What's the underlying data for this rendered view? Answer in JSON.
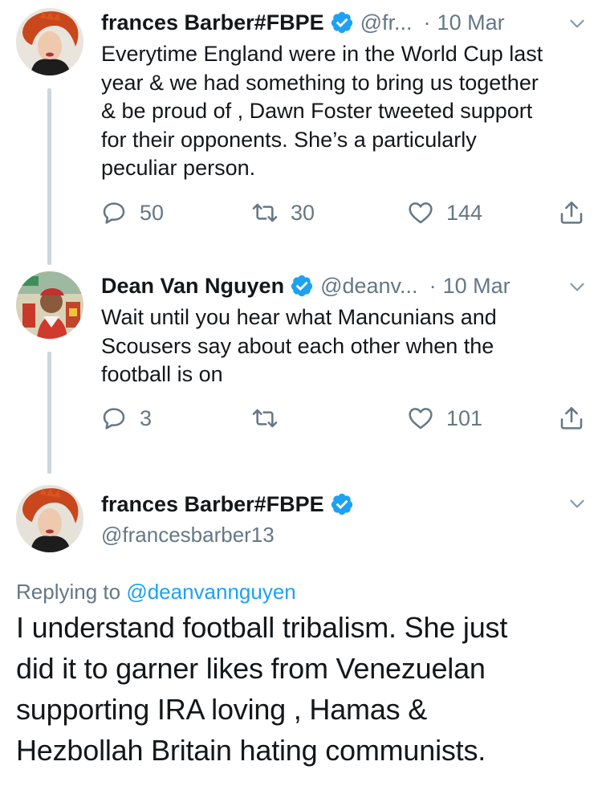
{
  "tweets": [
    {
      "name": "frances Barber#FBPE",
      "handle": "@fr...",
      "separator": "·",
      "date": "10 Mar",
      "text_lines": [
        "Everytime England were in the World Cup last",
        "year & we had something to bring us together",
        "& be proud of , Dawn Foster tweeted support",
        "for their opponents. She’s a particularly",
        "peculiar person."
      ],
      "replies": "50",
      "retweets": "30",
      "likes": "144"
    },
    {
      "name": "Dean Van Nguyen",
      "handle": "@deanv...",
      "separator": "·",
      "date": "10 Mar",
      "text_lines": [
        "Wait until you hear what Mancunians and",
        "Scousers say about each other when the",
        "football is on"
      ],
      "replies": "3",
      "retweets": "",
      "likes": "101"
    }
  ],
  "main_tweet": {
    "name": "frances Barber#FBPE",
    "handle": "@francesbarber13",
    "replying_prefix": "Replying to",
    "replying_to": "@deanvannguyen",
    "text_lines": [
      "I understand football tribalism. She just",
      "did it to garner likes from Venezuelan",
      "supporting IRA loving , Hamas &",
      "Hezbollah Britain hating communists."
    ]
  },
  "colors": {
    "accent": "#1da1f2",
    "muted": "#657786",
    "text": "#14171a",
    "thread_line": "#ccd6dd"
  },
  "icons": {
    "verified": "verified-badge-icon",
    "chevron": "chevron-down-icon",
    "reply": "reply-icon",
    "retweet": "retweet-icon",
    "like": "heart-icon",
    "share": "share-icon"
  }
}
